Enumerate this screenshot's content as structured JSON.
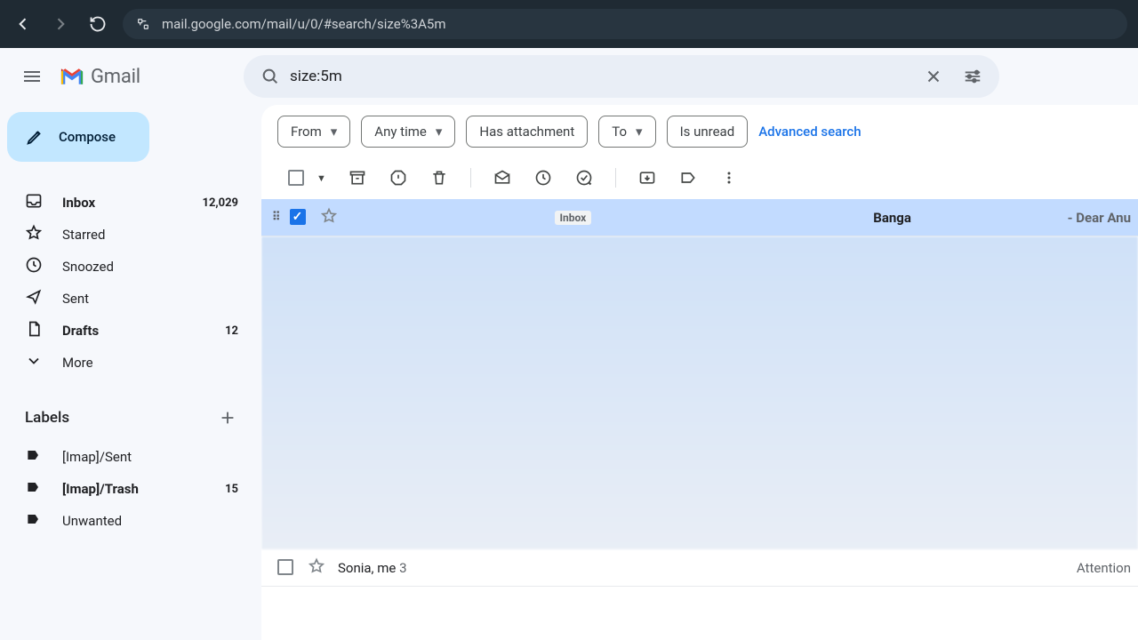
{
  "browser": {
    "url": "mail.google.com/mail/u/0/#search/size%3A5m"
  },
  "brand": "Gmail",
  "search": {
    "value": "size:5m"
  },
  "compose_label": "Compose",
  "nav": [
    {
      "icon": "inbox",
      "label": "Inbox",
      "count": "12,029",
      "bold": true
    },
    {
      "icon": "star",
      "label": "Starred",
      "count": "",
      "bold": false
    },
    {
      "icon": "clock",
      "label": "Snoozed",
      "count": "",
      "bold": false
    },
    {
      "icon": "send",
      "label": "Sent",
      "count": "",
      "bold": false
    },
    {
      "icon": "file",
      "label": "Drafts",
      "count": "12",
      "bold": true
    },
    {
      "icon": "chevron-down",
      "label": "More",
      "count": "",
      "bold": false
    }
  ],
  "labels_header": "Labels",
  "labels": [
    {
      "label": "[Imap]/Sent",
      "count": "",
      "bold": false
    },
    {
      "label": "[Imap]/Trash",
      "count": "15",
      "bold": true
    },
    {
      "label": "Unwanted",
      "count": "",
      "bold": false
    }
  ],
  "chips": {
    "from": "From",
    "anytime": "Any time",
    "has_attachment": "Has attachment",
    "to": "To",
    "is_unread": "Is unread",
    "advanced": "Advanced search"
  },
  "threads": {
    "row0": {
      "tag": "Inbox",
      "subject_prefix": "Banga",
      "snippet": " - Dear Anu"
    },
    "last": {
      "sender": "Sonia, me",
      "sender_count": "3",
      "snippet": "Attention"
    }
  }
}
